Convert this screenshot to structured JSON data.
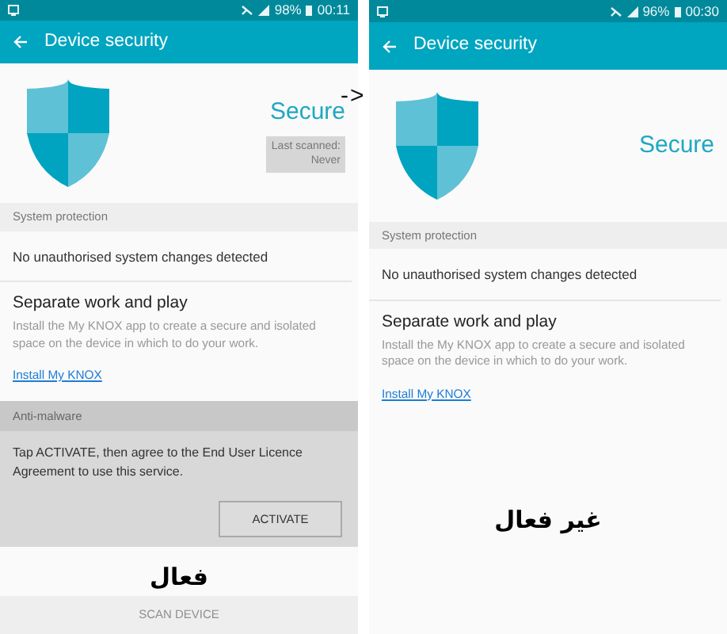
{
  "arrow": "->",
  "panels": [
    {
      "status_bar": {
        "battery": "98%",
        "time": "00:11"
      },
      "title": "Device security",
      "status": "Secure",
      "last_scanned": [
        "Last scanned:",
        "Never"
      ],
      "section": "System protection",
      "system_row": "No unauthorised system changes detected",
      "knox": {
        "title": "Separate work and play",
        "text": "Install the My KNOX app to create a secure and isolated space on the device in which to do your work.",
        "link": "Install My KNOX"
      },
      "anti_malware": {
        "header": "Anti-malware",
        "text": "Tap ACTIVATE, then agree to the End User Licence Agreement to use this service.",
        "button": "ACTIVATE"
      },
      "caption": "فعال",
      "scan_button": {
        "label": "SCAN DEVICE",
        "disabled": true
      }
    },
    {
      "status_bar": {
        "battery": "96%",
        "time": "00:30"
      },
      "title": "Device security",
      "status": "Secure",
      "section": "System protection",
      "system_row": "No unauthorised system changes detected",
      "knox": {
        "title": "Separate work and play",
        "text": "Install the My KNOX app to create a secure and isolated space on the device in which to do your work.",
        "link": "Install My KNOX"
      },
      "caption": "غير فعال"
    }
  ]
}
